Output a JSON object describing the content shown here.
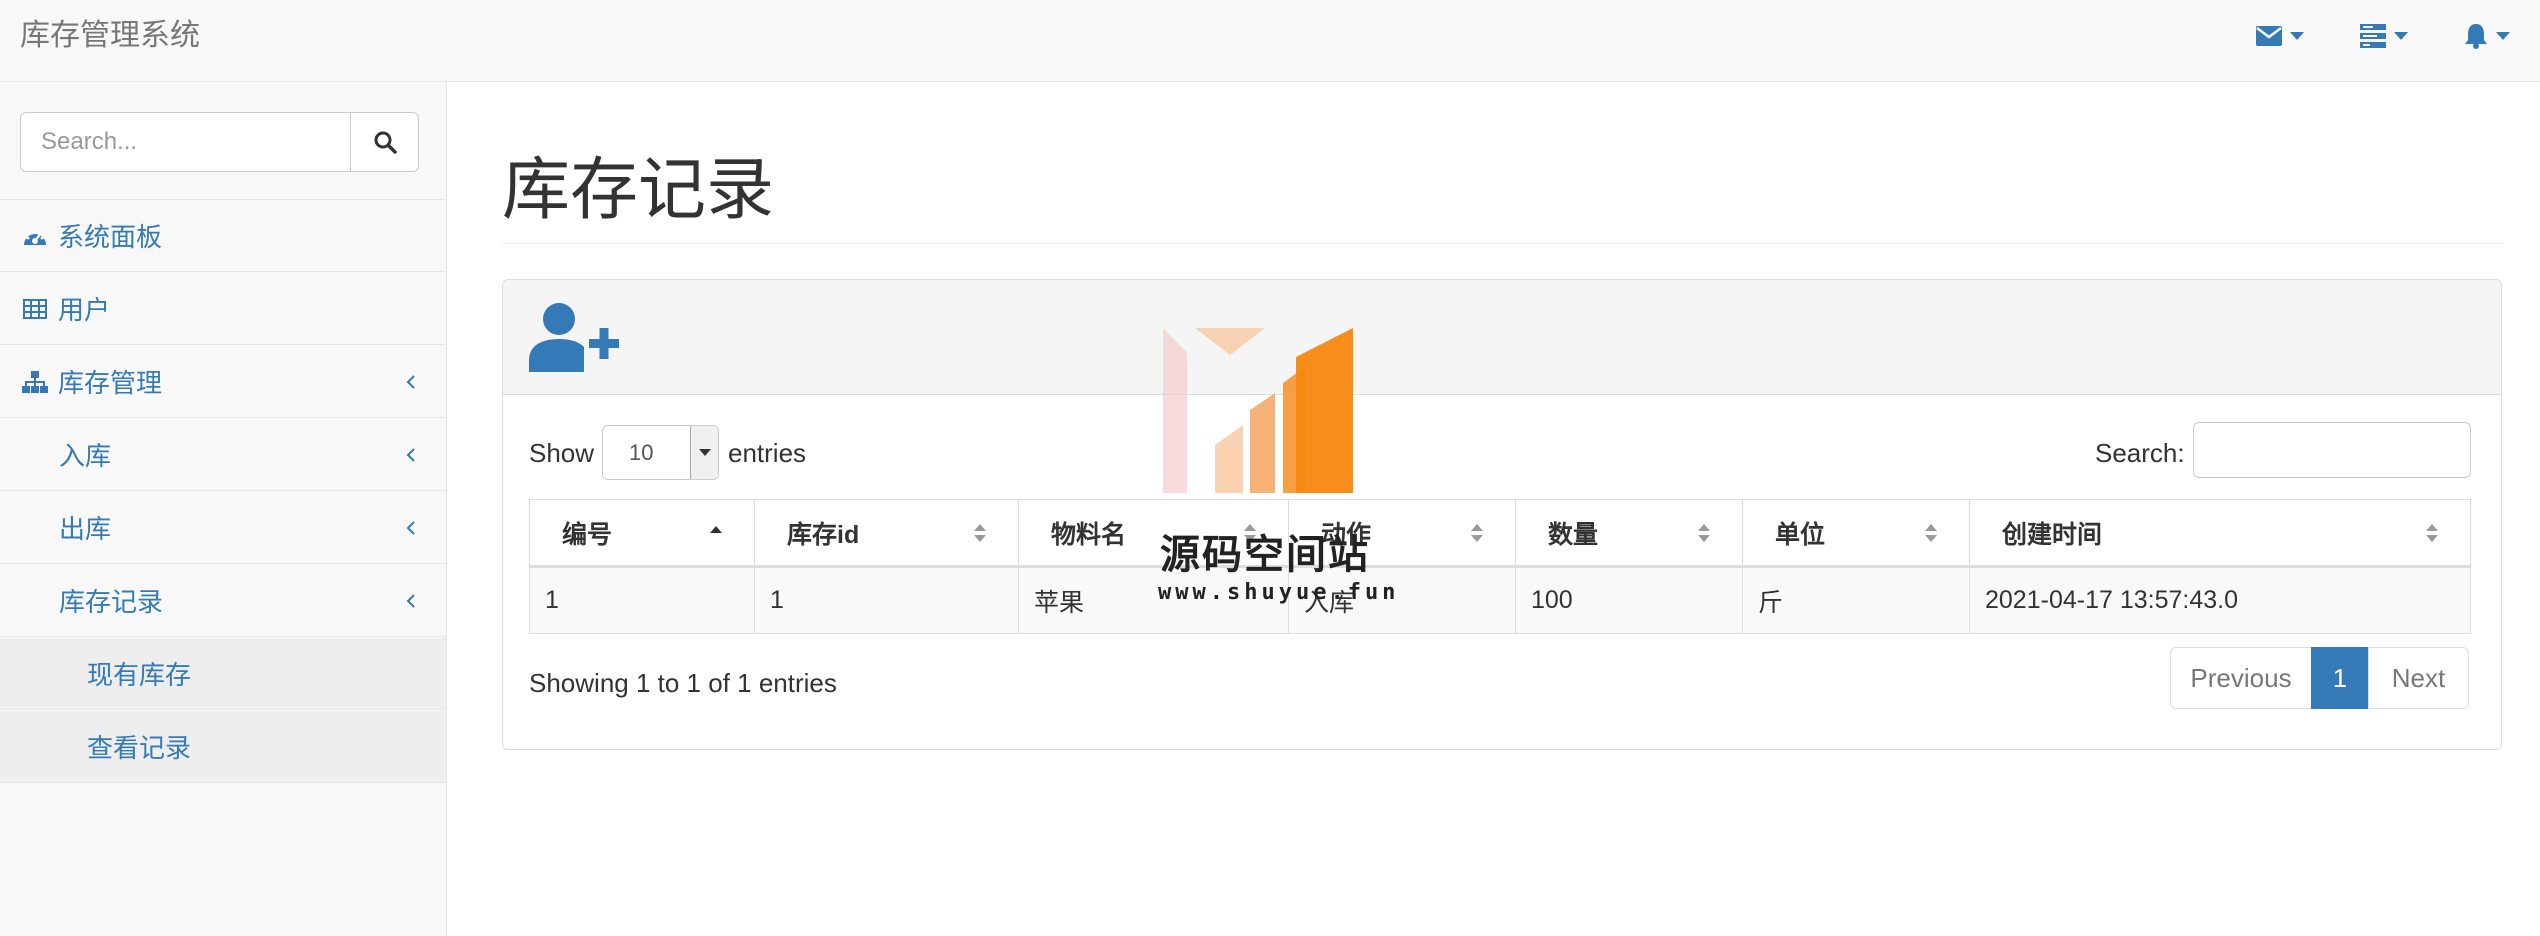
{
  "app": {
    "brand": "库存管理系统"
  },
  "nav": {
    "icons": [
      "envelope-icon",
      "tasks-icon",
      "bell-icon"
    ]
  },
  "sidebar": {
    "search_placeholder": "Search...",
    "items": [
      {
        "label": "系统面板",
        "icon": "dashboard-icon"
      },
      {
        "label": "用户",
        "icon": "table-icon"
      },
      {
        "label": "库存管理",
        "icon": "sitemap-icon"
      },
      {
        "label": "入库"
      },
      {
        "label": "出库"
      },
      {
        "label": "库存记录"
      },
      {
        "label": "现有库存"
      },
      {
        "label": "查看记录"
      }
    ]
  },
  "main": {
    "title": "库存记录",
    "length": {
      "show": "Show",
      "value": "10",
      "entries": "entries"
    },
    "search_label": "Search:",
    "table": {
      "headers": [
        "编号",
        "库存id",
        "物料名",
        "动作",
        "数量",
        "单位",
        "创建时间"
      ],
      "rows": [
        [
          "1",
          "1",
          "苹果",
          "入库",
          "100",
          "斤",
          "2021-04-17 13:57:43.0"
        ]
      ]
    },
    "info": "Showing 1 to 1 of 1 entries",
    "pager": {
      "previous": "Previous",
      "current": "1",
      "next": "Next"
    }
  },
  "watermark": {
    "title": "源码空间站",
    "url": "www.shuyue.fun"
  },
  "colors": {
    "link": "#337ab7",
    "navbar_bg": "#f8f8f8",
    "accent_orange": "#f7941d"
  }
}
